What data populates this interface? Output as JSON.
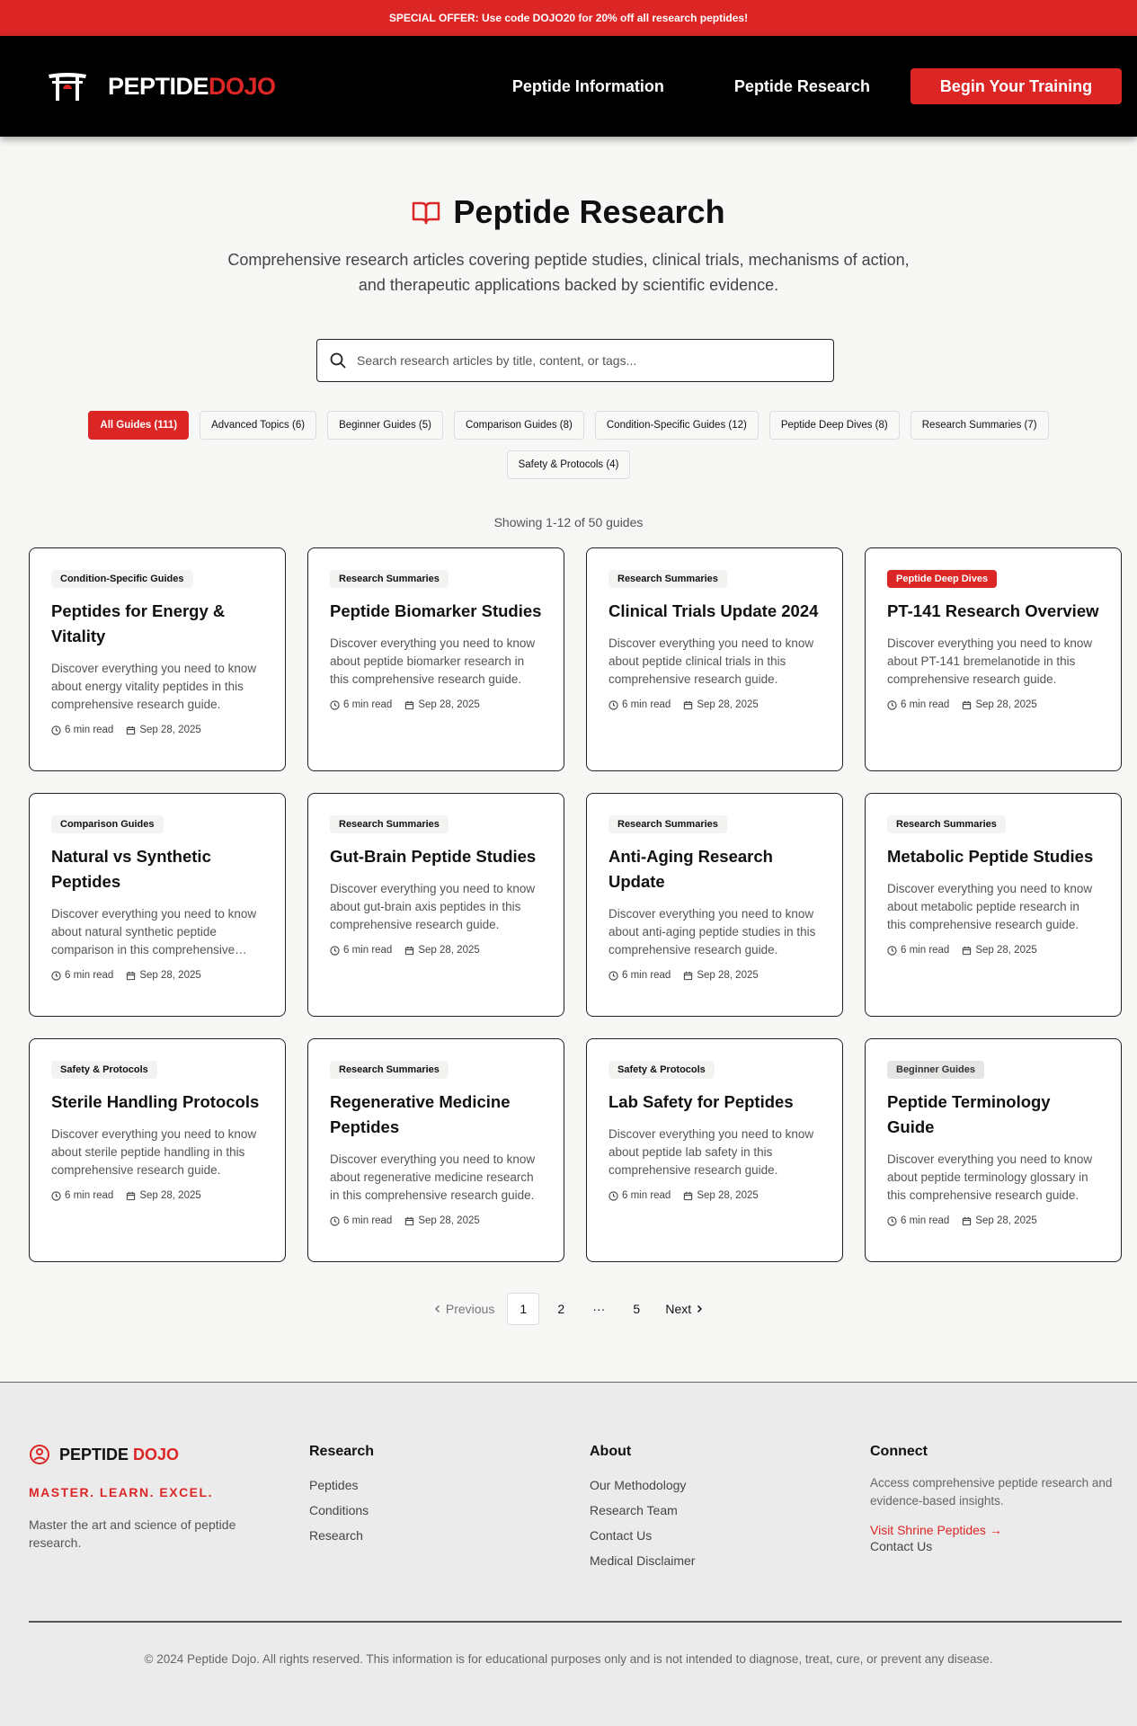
{
  "promo": {
    "text": "SPECIAL OFFER: Use code DOJO20 for 20% off all research peptides!"
  },
  "nav": {
    "logo_main": "PEPTIDE",
    "logo_accent": "DOJO",
    "link_info": "Peptide Information",
    "link_research": "Peptide Research",
    "cta": "Begin Your Training"
  },
  "hero": {
    "title": "Peptide Research",
    "subtitle": "Comprehensive research articles covering peptide studies, clinical trials, mechanisms of action, and therapeutic applications backed by scientific evidence."
  },
  "search": {
    "placeholder": "Search research articles by title, content, or tags..."
  },
  "filters": [
    "All Guides (111)",
    "Advanced Topics (6)",
    "Beginner Guides (5)",
    "Comparison Guides (8)",
    "Condition-Specific Guides (12)",
    "Peptide Deep Dives (8)",
    "Research Summaries (7)",
    "Safety & Protocols (4)"
  ],
  "showing": "Showing 1-12 of 50 guides",
  "cards": [
    {
      "badge": "Condition-Specific Guides",
      "title": "Peptides for Energy & Vitality",
      "desc": "Discover everything you need to know about energy vitality peptides in this comprehensive research guide.",
      "read": "6 min read",
      "date": "Sep 28, 2025"
    },
    {
      "badge": "Research Summaries",
      "title": "Peptide Biomarker Studies",
      "desc": "Discover everything you need to know about peptide biomarker research in this comprehensive research guide.",
      "read": "6 min read",
      "date": "Sep 28, 2025"
    },
    {
      "badge": "Research Summaries",
      "title": "Clinical Trials Update 2024",
      "desc": "Discover everything you need to know about peptide clinical trials in this comprehensive research guide.",
      "read": "6 min read",
      "date": "Sep 28, 2025"
    },
    {
      "badge": "Peptide Deep Dives",
      "title": "PT-141 Research Overview",
      "desc": "Discover everything you need to know about PT-141 bremelanotide in this comprehensive research guide.",
      "read": "6 min read",
      "date": "Sep 28, 2025"
    },
    {
      "badge": "Comparison Guides",
      "title": "Natural vs Synthetic Peptides",
      "desc": "Discover everything you need to know about natural synthetic peptide comparison in this comprehensive guide.",
      "read": "6 min read",
      "date": "Sep 28, 2025"
    },
    {
      "badge": "Research Summaries",
      "title": "Gut-Brain Peptide Studies",
      "desc": "Discover everything you need to know about gut-brain axis peptides in this comprehensive research guide.",
      "read": "6 min read",
      "date": "Sep 28, 2025"
    },
    {
      "badge": "Research Summaries",
      "title": "Anti-Aging Research Update",
      "desc": "Discover everything you need to know about anti-aging peptide studies in this comprehensive research guide.",
      "read": "6 min read",
      "date": "Sep 28, 2025"
    },
    {
      "badge": "Research Summaries",
      "title": "Metabolic Peptide Studies",
      "desc": "Discover everything you need to know about metabolic peptide research in this comprehensive research guide.",
      "read": "6 min read",
      "date": "Sep 28, 2025"
    },
    {
      "badge": "Safety & Protocols",
      "title": "Sterile Handling Protocols",
      "desc": "Discover everything you need to know about sterile peptide handling in this comprehensive research guide.",
      "read": "6 min read",
      "date": "Sep 28, 2025"
    },
    {
      "badge": "Research Summaries",
      "title": "Regenerative Medicine Peptides",
      "desc": "Discover everything you need to know about regenerative medicine research in this comprehensive research guide.",
      "read": "6 min read",
      "date": "Sep 28, 2025"
    },
    {
      "badge": "Safety & Protocols",
      "title": "Lab Safety for Peptides",
      "desc": "Discover everything you need to know about peptide lab safety in this comprehensive research guide.",
      "read": "6 min read",
      "date": "Sep 28, 2025"
    },
    {
      "badge": "Beginner Guides",
      "title": "Peptide Terminology Guide",
      "desc": "Discover everything you need to know about peptide terminology glossary in this comprehensive research guide.",
      "read": "6 min read",
      "date": "Sep 28, 2025"
    }
  ],
  "pagination": {
    "prev": "Previous",
    "pages": [
      "1",
      "2",
      "···",
      "5"
    ],
    "next": "Next"
  },
  "footer": {
    "logo_main": "PEPTIDE",
    "logo_accent": "DOJO",
    "tagline": "MASTER. LEARN. EXCEL.",
    "about": "Master the art and science of peptide research.",
    "research_head": "Research",
    "research_links": [
      "Peptides",
      "Conditions",
      "Research"
    ],
    "about_head": "About",
    "about_links": [
      "Our Methodology",
      "Research Team",
      "Contact Us",
      "Medical Disclaimer"
    ],
    "connect_head": "Connect",
    "connect_desc": "Access comprehensive peptide research and evidence-based insights.",
    "shrine": "Visit Shrine Peptides →",
    "contact": "Contact Us",
    "copyright": "© 2024 Peptide Dojo. All rights reserved. This information is for educational purposes only and is not intended to diagnose, treat, cure, or prevent any disease."
  },
  "colors": {
    "accent": "#dc2626",
    "nav_bg": "#000000",
    "page_bg": "#f7f7f5"
  }
}
